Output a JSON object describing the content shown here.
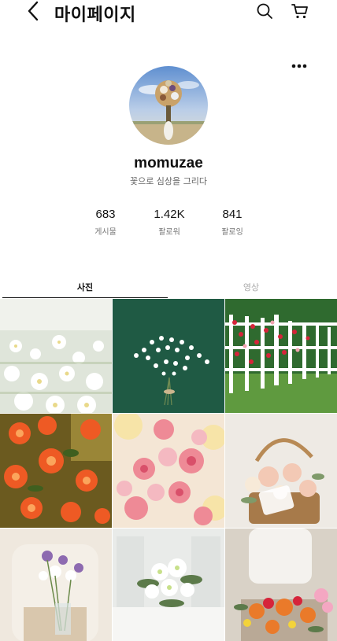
{
  "header": {
    "title": "마이페이지",
    "back_icon": "chevron-left-icon",
    "search_icon": "search-icon",
    "cart_icon": "cart-icon"
  },
  "profile": {
    "more_icon": "more-horizontal-icon",
    "username": "momuzae",
    "bio": "꽃으로 심상을 그리다"
  },
  "stats": [
    {
      "value": "683",
      "label": "게시물"
    },
    {
      "value": "1.42K",
      "label": "팔로워"
    },
    {
      "value": "841",
      "label": "팔로잉"
    }
  ],
  "tabs": [
    {
      "label": "사진",
      "active": true
    },
    {
      "label": "영상",
      "active": false
    }
  ],
  "colors": {
    "accent": "#111111",
    "muted": "#777777",
    "inactive_tab": "#aaaaaa"
  }
}
